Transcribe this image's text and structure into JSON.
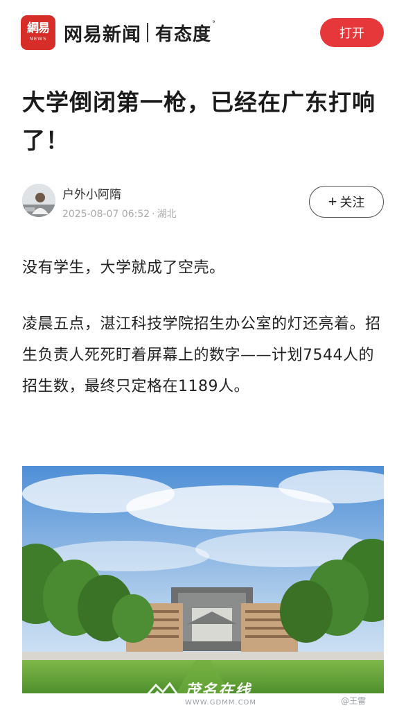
{
  "header": {
    "logo_text": "網易",
    "logo_sub": "NEWS",
    "brand_name": "网易新闻",
    "slogan": "有态度",
    "open_label": "打开",
    "accent_color": "#e6373a"
  },
  "article": {
    "title": "大学倒闭第一枪，已经在广东打响了！",
    "author": "户外小阿隋",
    "datetime": "2025-08-07 06:52",
    "location": "湖北",
    "follow_label": "关注",
    "paragraphs": [
      "没有学生，大学就成了空壳。",
      "凌晨五点，湛江科技学院招生办公室的灯还亮着。招生负责人死死盯着屏幕上的数字——计划7544人的招生数，最终只定格在1189人。"
    ]
  },
  "watermarks": {
    "site_name": "茂名在线",
    "site_url": "WWW.GDMM.COM",
    "weibo": "@王雷"
  }
}
